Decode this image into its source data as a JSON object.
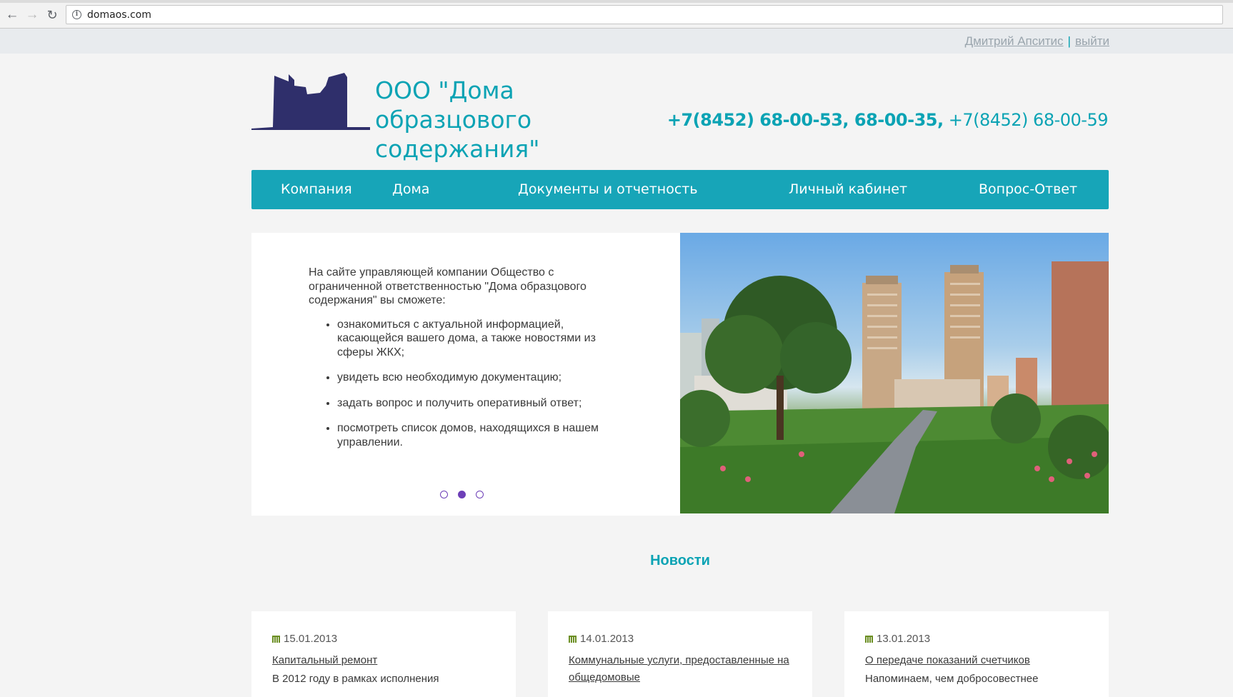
{
  "browser": {
    "url": "domaos.com",
    "back_icon": "arrow-left-icon",
    "forward_icon": "arrow-right-icon",
    "reload_icon": "reload-icon"
  },
  "user_bar": {
    "user_name": "Дмитрий Апситис",
    "separator": "|",
    "logout": "выйти"
  },
  "header": {
    "company_line1": "ООО \"Дома образцового",
    "company_line2": "содержания\"",
    "phone_bold": "+7(8452) 68-00-53, 68-00-35,",
    "phone_regular": " +7(8452) 68-00-59"
  },
  "nav": {
    "items": [
      "Компания",
      "Дома",
      "Документы и отчетность",
      "Личный кабинет",
      "Вопрос-Ответ"
    ]
  },
  "slider": {
    "intro": "На сайте управляющей компании Общество с ограниченной ответственностью \"Дома образцового содержания\" вы сможете:",
    "bullets": [
      "ознакомиться с актуальной информацией, касающейся вашего дома, а также новостями из сферы ЖКХ;",
      "увидеть всю необходимую документацию;",
      "задать вопрос и получить оперативный ответ;",
      "посмотреть список домов, находящихся в нашем управлении."
    ],
    "active_dot": 2,
    "dot_count": 3
  },
  "news": {
    "heading": "Новости",
    "items": [
      {
        "date": "15.01.2013",
        "title": "Капитальный ремонт",
        "excerpt": "В 2012 году в рамках исполнения"
      },
      {
        "date": "14.01.2013",
        "title": "Коммунальные услуги, предоставленные на общедомовые",
        "excerpt": ""
      },
      {
        "date": "13.01.2013",
        "title": "О передаче показаний счетчиков",
        "excerpt": "Напоминаем, чем добросовестнее"
      }
    ]
  },
  "colors": {
    "accent": "#17a5b8",
    "logo": "#2f2f6b",
    "dot": "#6d3fb7"
  }
}
